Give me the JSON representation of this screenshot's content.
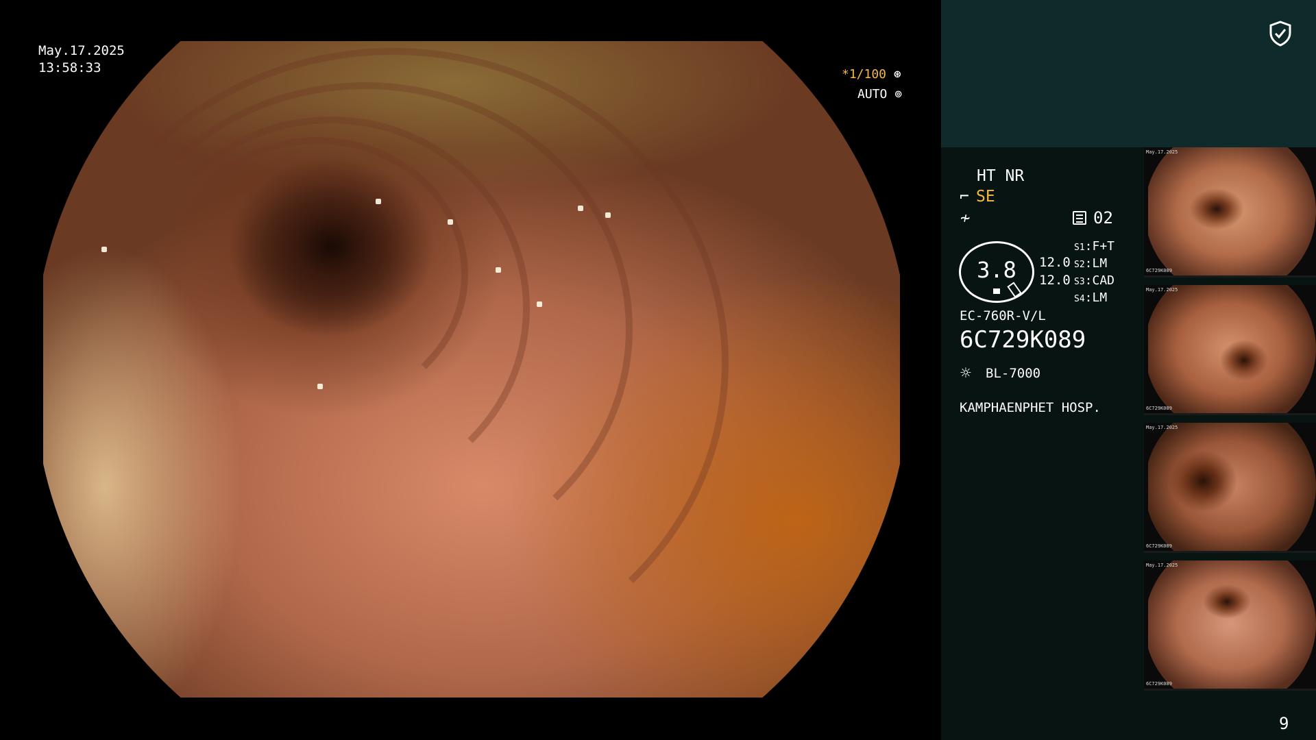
{
  "overlay": {
    "date": "May.17.2025",
    "time": "13:58:33",
    "shutter": "*1/100",
    "shutter_icon": "aperture-icon",
    "iris_mode": "AUTO",
    "iris_icon": "iris-icon"
  },
  "panel": {
    "shield_icon": "shield-check-icon",
    "ht_nr": "HT NR",
    "enhancement": "SE",
    "memo_value": "02",
    "gauge_value": "3.8",
    "value_1": "12.0",
    "value_2": "12.0",
    "switches": [
      {
        "key": "S1",
        "value": "F+T"
      },
      {
        "key": "S2",
        "value": "LM"
      },
      {
        "key": "S3",
        "value": "CAD"
      },
      {
        "key": "S4",
        "value": "LM"
      }
    ],
    "scope_model": "EC-760R-V/L",
    "scope_serial": "6C729K089",
    "light_source": "BL-7000",
    "hospital": "KAMPHAENPHET HOSP."
  },
  "thumbnails": [
    {
      "caption_top": "May.17.2025",
      "caption_bottom": "6C729K089"
    },
    {
      "caption_top": "May.17.2025",
      "caption_bottom": "6C729K089"
    },
    {
      "caption_top": "May.17.2025",
      "caption_bottom": "6C729K089"
    },
    {
      "caption_top": "May.17.2025",
      "caption_bottom": "6C729K089"
    }
  ],
  "page_number": "9",
  "colors": {
    "accent_orange": "#f5b93c",
    "panel_top": "#0f2a2b",
    "panel_bg": "#081412"
  }
}
